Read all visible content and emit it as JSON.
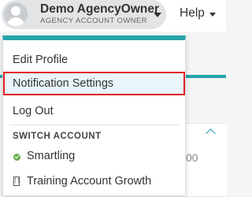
{
  "header": {
    "account_name": "Demo AgencyOwner",
    "account_role": "AGENCY ACCOUNT OWNER",
    "help_label": "Help",
    "avatar_icon": "avatar-icon",
    "caret_icon": "caret-down-icon"
  },
  "menu": {
    "items": [
      {
        "label": "Edit Profile"
      },
      {
        "label": "Notification Settings",
        "highlighted": true
      },
      {
        "label": "Log Out"
      }
    ],
    "switch_label": "SWITCH ACCOUNT",
    "accounts": [
      {
        "label": "Smartling",
        "icon": "check-circle-icon",
        "active": true
      },
      {
        "label": "Training Account Growth",
        "icon": "building-icon",
        "active": false
      }
    ]
  },
  "background": {
    "partial_value": "00"
  },
  "colors": {
    "accent": "#26a3ab",
    "highlight_border": "#e01f26",
    "highlight_bg": "#e9f5fa",
    "active_check": "#6ab04c"
  }
}
